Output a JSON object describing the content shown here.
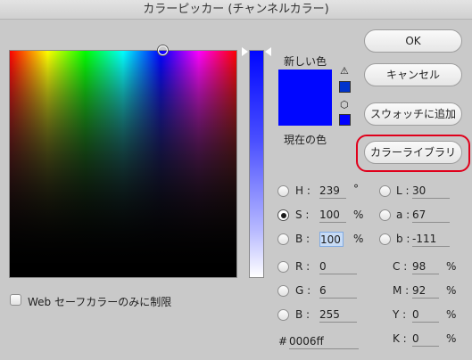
{
  "window": {
    "title": "カラーピッカー (チャンネルカラー)"
  },
  "preview": {
    "new_label": "新しい色",
    "current_label": "現在の色",
    "new_color": "#0006ff",
    "current_color": "#0006ff",
    "websafe_color": "#0033cc",
    "websafe_swatch": "#0000ff"
  },
  "buttons": {
    "ok": "OK",
    "cancel": "キャンセル",
    "add_to_swatches": "スウォッチに追加",
    "color_libraries": "カラーライブラリ"
  },
  "hsb": {
    "h": {
      "label": "H :",
      "value": "239",
      "unit": "°"
    },
    "s": {
      "label": "S :",
      "value": "100",
      "unit": "%"
    },
    "b": {
      "label": "B :",
      "value": "100",
      "unit": "%"
    }
  },
  "lab": {
    "l": {
      "label": "L :",
      "value": "30"
    },
    "a": {
      "label": "a :",
      "value": "67"
    },
    "b": {
      "label": "b :",
      "value": "-111"
    }
  },
  "rgb": {
    "r": {
      "label": "R :",
      "value": "0"
    },
    "g": {
      "label": "G :",
      "value": "6"
    },
    "b": {
      "label": "B :",
      "value": "255"
    }
  },
  "cmyk": {
    "c": {
      "label": "C :",
      "value": "98",
      "unit": "%"
    },
    "m": {
      "label": "M :",
      "value": "92",
      "unit": "%"
    },
    "y": {
      "label": "Y :",
      "value": "0",
      "unit": "%"
    },
    "k": {
      "label": "K :",
      "value": "0",
      "unit": "%"
    }
  },
  "hex": {
    "label": "#",
    "value": "0006ff"
  },
  "web_only": {
    "label": "Web セーフカラーのみに制限",
    "checked": false
  },
  "selected_channel": "S"
}
